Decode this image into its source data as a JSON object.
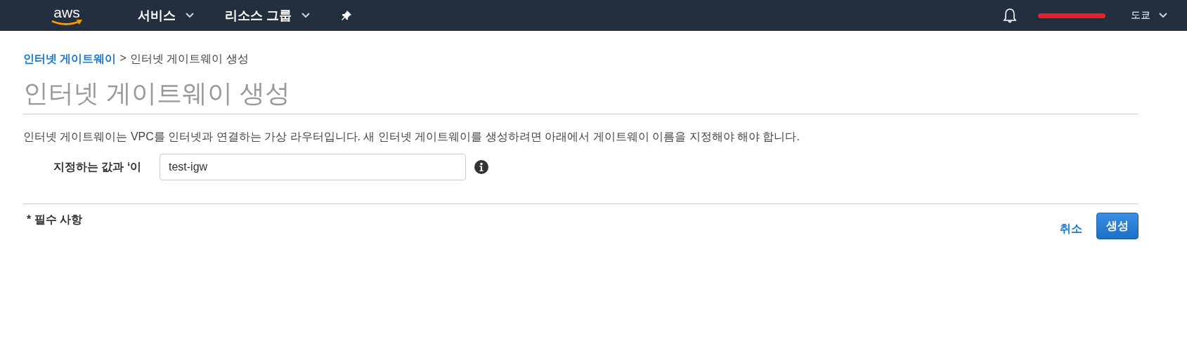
{
  "nav": {
    "logo": "aws",
    "menus": [
      {
        "label": "서비스"
      },
      {
        "label": "리소스 그룹"
      }
    ],
    "region": "도쿄"
  },
  "breadcrumb": {
    "link": "인터넷 게이트웨이",
    "separator": ">",
    "current": "인터넷 게이트웨이 생성"
  },
  "title": "인터넷 게이트웨이 생성",
  "description": "인터넷 게이트웨이는 VPC를 인터넷과 연결하는 가상 라우터입니다. 새 인터넷 게이트웨이를 생성하려면 아래에서 게이트웨이 이름을 지정해야 해야 합니다.",
  "field": {
    "label": "지정하는 값과 ‘이",
    "value": "test-igw"
  },
  "footer": {
    "required_note": "* 필수 사항",
    "buttons": [
      {
        "label": "취소",
        "kind": "link"
      },
      {
        "label": "생성",
        "kind": "primary"
      }
    ]
  }
}
